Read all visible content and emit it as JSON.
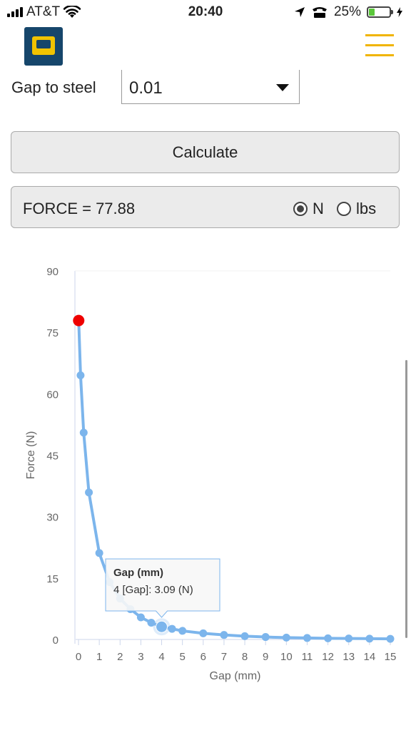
{
  "status_bar": {
    "carrier": "AT&T",
    "time": "20:40",
    "battery": "25%",
    "icons": [
      "signal-icon",
      "wifi-icon",
      "location-icon",
      "tty-icon",
      "battery-icon",
      "charging-icon"
    ]
  },
  "header": {
    "logo": "logo-icon",
    "menu": "hamburger-menu-icon",
    "accent_color": "#f0b400",
    "logo_colors": [
      "#16466b",
      "#f1c300"
    ]
  },
  "form": {
    "gap_label": "Gap to steel",
    "gap_value": "0.01",
    "calculate_label": "Calculate"
  },
  "result": {
    "text": "FORCE = 77.88",
    "units": [
      {
        "label": "N",
        "checked": true
      },
      {
        "label": "lbs",
        "checked": false
      }
    ]
  },
  "chart_data": {
    "type": "line",
    "xlabel": "Gap (mm)",
    "ylabel": "Force (N)",
    "xlim": [
      0,
      15
    ],
    "ylim": [
      0,
      90
    ],
    "x_ticks": [
      "0",
      "1",
      "2",
      "3",
      "4",
      "5",
      "6",
      "7",
      "8",
      "9",
      "10",
      "11",
      "12",
      "13",
      "14",
      "15"
    ],
    "y_ticks": [
      "0",
      "15",
      "30",
      "45",
      "60",
      "75",
      "90"
    ],
    "series": [
      {
        "color": "#7cb5ec",
        "x": [
          0.01,
          0.1,
          0.25,
          0.5,
          1,
          1.5,
          2,
          2.5,
          3,
          3.5,
          4,
          4.5,
          5,
          6,
          7,
          8,
          9,
          10,
          11,
          12,
          13,
          14,
          15
        ],
        "y": [
          77.88,
          64.5,
          50.5,
          35.9,
          21.1,
          14.0,
          10.0,
          7.4,
          5.4,
          4.1,
          3.09,
          2.6,
          2.1,
          1.5,
          1.1,
          0.8,
          0.6,
          0.45,
          0.36,
          0.29,
          0.24,
          0.2,
          0.16
        ]
      }
    ],
    "highlight_point": {
      "x": 0.01,
      "y": 77.88,
      "color": "#ee0000"
    },
    "hover_point": {
      "x": 4,
      "y": 3.09
    },
    "tooltip": {
      "title": "Gap (mm)",
      "text": "4 [Gap]: 3.09 (N)"
    },
    "grid": false,
    "legend": "none"
  }
}
